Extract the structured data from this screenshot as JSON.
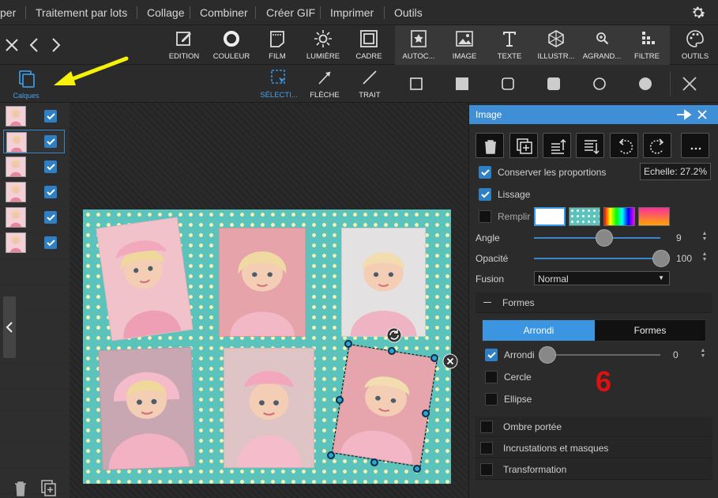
{
  "menu": {
    "items": [
      "per",
      "Traitement par lots",
      "Collage",
      "Combiner",
      "Créer GIF",
      "Imprimer",
      "Outils"
    ]
  },
  "toolbar": {
    "tools": [
      "EDITION",
      "COULEUR",
      "FILM",
      "LUMIÈRE",
      "CADRE",
      "AUTOC...",
      "IMAGE",
      "TEXTE",
      "ILLUSTR...",
      "AGRAND...",
      "FILTRE",
      "OUTILS"
    ]
  },
  "toolbar2": {
    "layers_label": "Calques",
    "selection_label": "SÉLECTI...",
    "arrow_label": "FLÈCHE",
    "line_label": "TRAIT"
  },
  "layers": {
    "count": 6,
    "selected_index": 1
  },
  "panel": {
    "title": "Image",
    "keep_ratio": {
      "label": "Conserver les proportions",
      "checked": true
    },
    "scale_label": "Echelle: 27.2%",
    "smoothing": {
      "label": "Lissage",
      "checked": true
    },
    "fill": {
      "label": "Remplir",
      "checked": false
    },
    "angle": {
      "label": "Angle",
      "value": "9",
      "fraction": 0.54
    },
    "opacity": {
      "label": "Opacité",
      "value": "100",
      "fraction": 1.0
    },
    "blend": {
      "label": "Fusion",
      "value": "Normal"
    },
    "shapes_section": {
      "label": "Formes",
      "expanded": true
    },
    "tabs": {
      "active": "Arrondi",
      "other": "Formes"
    },
    "rounded": {
      "label": "Arrondi",
      "checked": true,
      "value": "0",
      "fraction": 0
    },
    "circle": {
      "label": "Cercle",
      "checked": false
    },
    "ellipse": {
      "label": "Ellipse",
      "checked": false
    },
    "annotation": "6",
    "drop_shadow": {
      "label": "Ombre portée",
      "checked": false
    },
    "inlays": {
      "label": "Incrustations et masques",
      "checked": false
    },
    "transform": {
      "label": "Transformation",
      "checked": false
    }
  },
  "colors": {
    "accent": "#3b95e0",
    "poster_bg": "#5cc2bc",
    "dots": "#f4f2b4",
    "annotation": "#e01010",
    "arrow": "#f5f10a"
  }
}
